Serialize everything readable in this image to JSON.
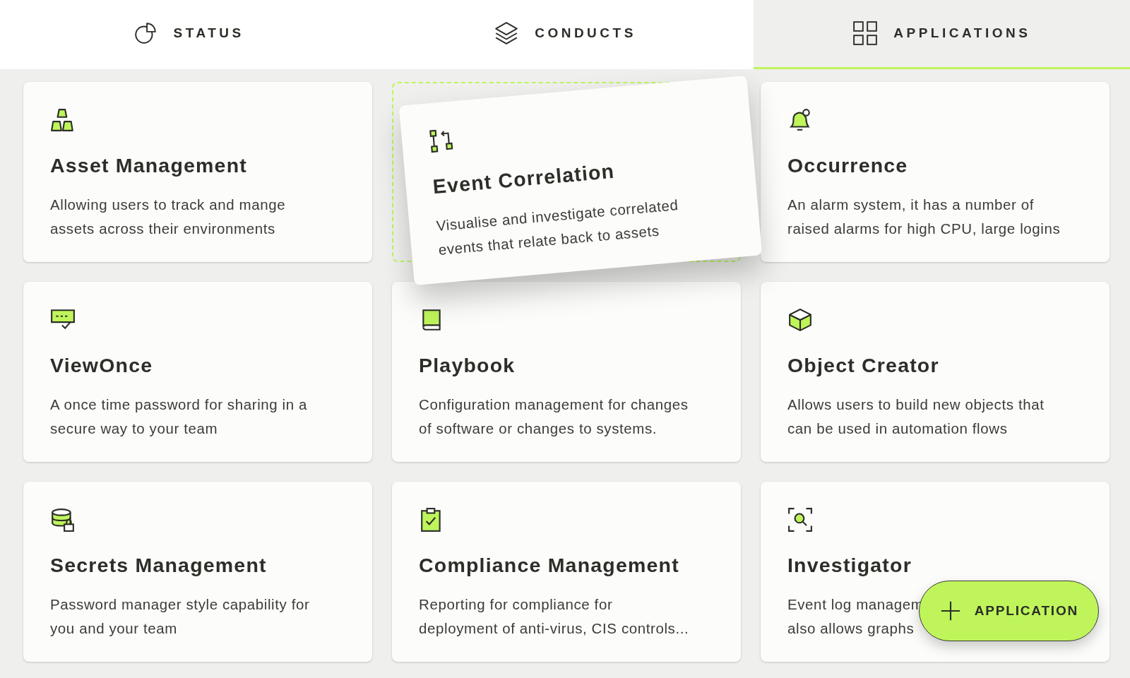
{
  "tabs": [
    {
      "label": "STATUS",
      "selected": false
    },
    {
      "label": "CONDUCTS",
      "selected": false
    },
    {
      "label": "APPLICATIONS",
      "selected": true
    }
  ],
  "applications": [
    {
      "title": "Asset Management",
      "description": "Allowing users to track and mange\nassets across their environments",
      "dragging": false
    },
    {
      "title": "Event Correlation",
      "description": "Visualise and investigate correlated\nevents that relate back to assets",
      "dragging": true
    },
    {
      "title": "Occurrence",
      "description": "An alarm system, it has a number of\nraised alarms for high CPU, large logins",
      "dragging": false
    },
    {
      "title": "ViewOnce",
      "description": "A once time password for sharing in a\nsecure way to your team",
      "dragging": false
    },
    {
      "title": "Playbook",
      "description": "Configuration management for changes\nof software or changes to systems.",
      "dragging": false
    },
    {
      "title": "Object Creator",
      "description": "Allows users to build new objects that\ncan be used in automation flows",
      "dragging": false
    },
    {
      "title": "Secrets Management",
      "description": "Password manager style capability for\nyou and your team",
      "dragging": false
    },
    {
      "title": "Compliance Management",
      "description": "Reporting for compliance for\ndeployment of anti-virus, CIS controls...",
      "dragging": false
    },
    {
      "title": "Investigator",
      "description": "Event log managem\nalso allows graphs",
      "dragging": false
    }
  ],
  "add_button": {
    "label": "APPLICATION"
  }
}
